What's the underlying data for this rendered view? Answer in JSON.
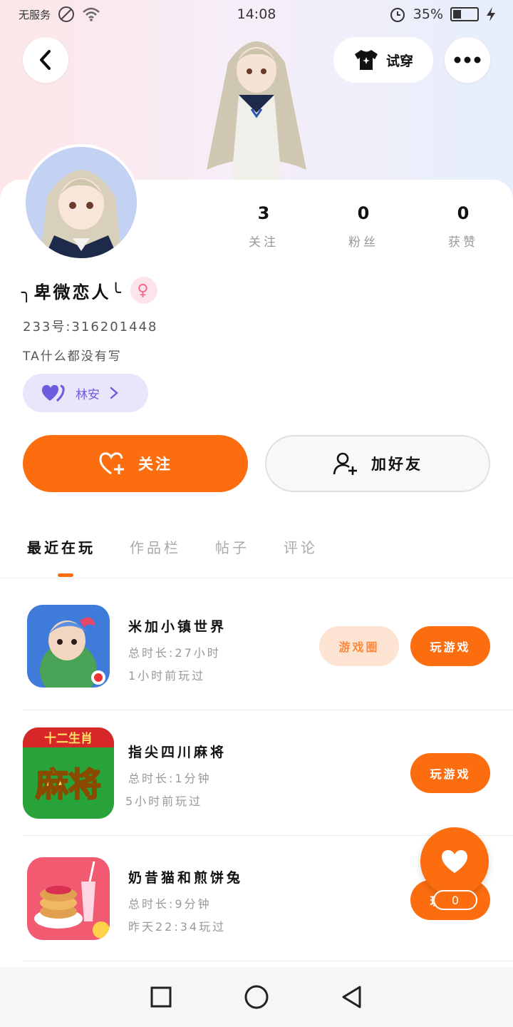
{
  "status_bar": {
    "carrier": "无服务",
    "time": "14:08",
    "battery_percent": "35%",
    "battery_level": 0.35
  },
  "header": {
    "try_on_label": "试穿"
  },
  "profile": {
    "name": "╮卑微恋人╰",
    "uid": "233号:316201448",
    "bio": "TA什么都没有写",
    "tag_label": "林安",
    "stats": [
      {
        "value": "3",
        "label": "关注"
      },
      {
        "value": "0",
        "label": "粉丝"
      },
      {
        "value": "0",
        "label": "获赞"
      }
    ]
  },
  "actions": {
    "follow_label": "关注",
    "add_friend_label": "加好友"
  },
  "tabs": [
    {
      "label": "最近在玩",
      "active": true
    },
    {
      "label": "作品栏",
      "active": false
    },
    {
      "label": "帖子",
      "active": false
    },
    {
      "label": "评论",
      "active": false
    }
  ],
  "games": [
    {
      "title": "米加小镇世界",
      "duration": "总时长:27小时",
      "last_played": "1小时前玩过",
      "circle_label": "游戏圈",
      "play_label": "玩游戏"
    },
    {
      "title": "指尖四川麻将",
      "duration": "总时长:1分钟",
      "last_played": "5小时前玩过",
      "icon_text": "麻将",
      "icon_banner": "十二生肖",
      "play_label": "玩游戏"
    },
    {
      "title": "奶昔猫和煎饼兔",
      "duration": "总时长:9分钟",
      "last_played": "昨天22:34玩过",
      "play_label": "玩游戏"
    }
  ],
  "fab": {
    "count": "0"
  },
  "colors": {
    "accent": "#fb6d0f",
    "tag_bg": "#e9e6fb",
    "tag_fg": "#6b5ce0"
  }
}
